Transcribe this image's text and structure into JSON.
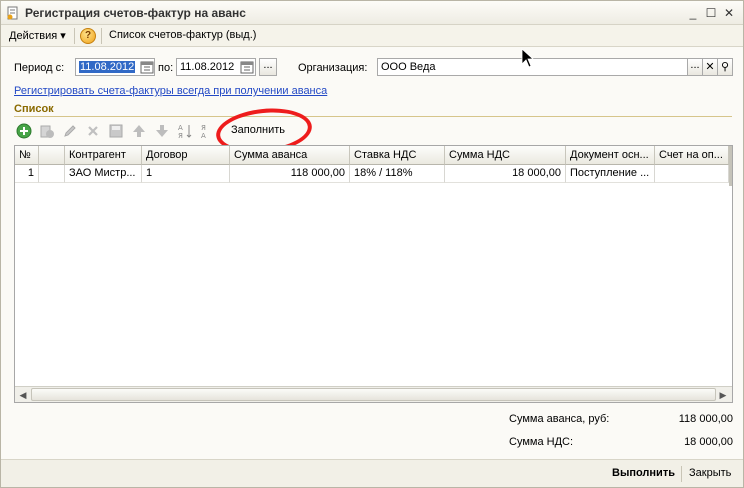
{
  "window": {
    "title": "Регистрация счетов-фактур на аванс"
  },
  "menubar": {
    "actions_label": "Действия",
    "help_label": "?",
    "list_label": "Список счетов-фактур (выд.)"
  },
  "filters": {
    "period_label": "Период с:",
    "period_from": "11.08.2012",
    "to_label": "по:",
    "period_to": "11.08.2012",
    "dots_label": "...",
    "org_label": "Организация:",
    "org_value": "ООО Веда",
    "org_dots": "...",
    "org_clear": "✕",
    "org_search": "⚲"
  },
  "link": {
    "text": "Регистрировать счета-фактуры всегда при получении аванса"
  },
  "section": {
    "title": "Список"
  },
  "toolbar": {
    "fill_label": "Заполнить"
  },
  "table": {
    "headers": [
      "№",
      "",
      "Контрагент",
      "Договор",
      "Сумма аванса",
      "Ставка НДС",
      "Сумма НДС",
      "Документ осн...",
      "Счет на оп..."
    ],
    "rows": [
      [
        "1",
        "",
        "ЗАО Мистр...",
        "1",
        "118 000,00",
        "18% / 118%",
        "18 000,00",
        "Поступление ...",
        ""
      ]
    ]
  },
  "totals": {
    "advance_label": "Сумма аванса, руб:",
    "advance_value": "118 000,00",
    "vat_label": "Сумма НДС:",
    "vat_value": "18 000,00"
  },
  "footer": {
    "execute_label": "Выполнить",
    "close_label": "Закрыть"
  }
}
